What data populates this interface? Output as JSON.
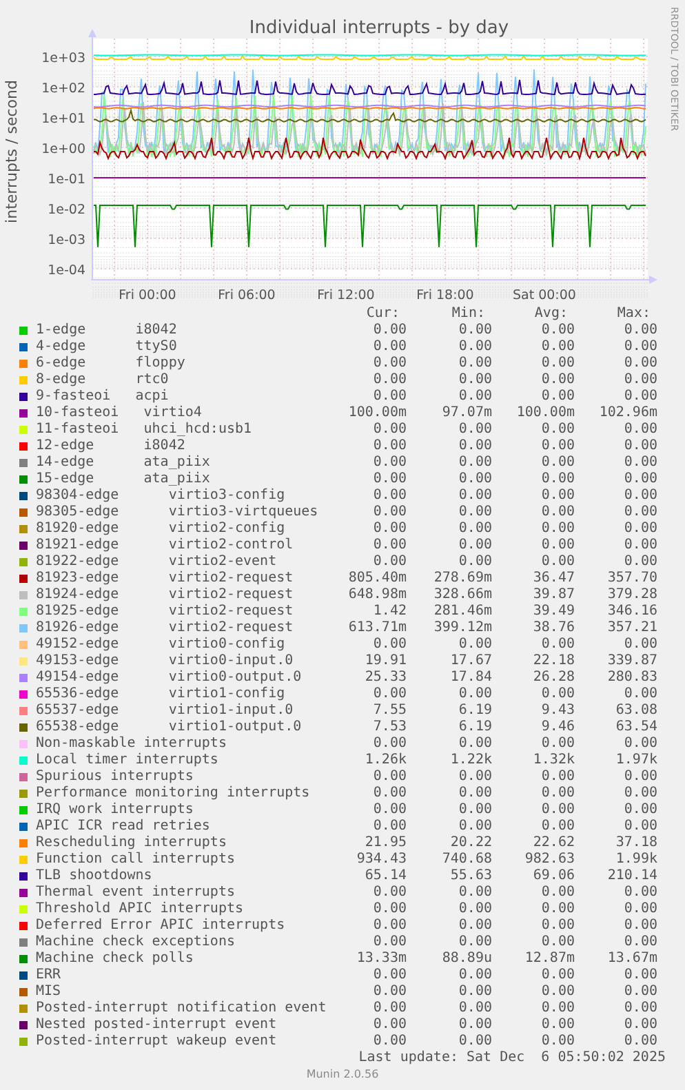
{
  "chart": {
    "title": "Individual interrupts - by day",
    "ylabel": "interrupts / second",
    "credit": "RRDTOOL / TOBI OETIKER",
    "yticks": [
      "1e+03",
      "1e+02",
      "1e+01",
      "1e+00",
      "1e-01",
      "1e-02",
      "1e-03",
      "1e-04"
    ],
    "xticks": [
      "Fri 00:00",
      "Fri 06:00",
      "Fri 12:00",
      "Fri 18:00",
      "Sat 00:00"
    ]
  },
  "legend": {
    "columns": [
      "Cur:",
      "Min:",
      "Avg:",
      "Max:"
    ],
    "rows": [
      {
        "label": "1-edge      i8042",
        "color": "#00cc00",
        "cur": "0.00",
        "min": "0.00",
        "avg": "0.00",
        "max": "0.00"
      },
      {
        "label": "4-edge      ttyS0",
        "color": "#0066b3",
        "cur": "0.00",
        "min": "0.00",
        "avg": "0.00",
        "max": "0.00"
      },
      {
        "label": "6-edge      floppy",
        "color": "#ff8000",
        "cur": "0.00",
        "min": "0.00",
        "avg": "0.00",
        "max": "0.00"
      },
      {
        "label": "8-edge      rtc0",
        "color": "#ffcc00",
        "cur": "0.00",
        "min": "0.00",
        "avg": "0.00",
        "max": "0.00"
      },
      {
        "label": "9-fasteoi   acpi",
        "color": "#330099",
        "cur": "0.00",
        "min": "0.00",
        "avg": "0.00",
        "max": "0.00"
      },
      {
        "label": "10-fasteoi   virtio4",
        "color": "#990099",
        "cur": "100.00m",
        "min": "97.07m",
        "avg": "100.00m",
        "max": "102.96m"
      },
      {
        "label": "11-fasteoi   uhci_hcd:usb1",
        "color": "#ccff00",
        "cur": "0.00",
        "min": "0.00",
        "avg": "0.00",
        "max": "0.00"
      },
      {
        "label": "12-edge      i8042",
        "color": "#ff0000",
        "cur": "0.00",
        "min": "0.00",
        "avg": "0.00",
        "max": "0.00"
      },
      {
        "label": "14-edge      ata_piix",
        "color": "#808080",
        "cur": "0.00",
        "min": "0.00",
        "avg": "0.00",
        "max": "0.00"
      },
      {
        "label": "15-edge      ata_piix",
        "color": "#008f00",
        "cur": "0.00",
        "min": "0.00",
        "avg": "0.00",
        "max": "0.00"
      },
      {
        "label": "98304-edge      virtio3-config",
        "color": "#00487d",
        "cur": "0.00",
        "min": "0.00",
        "avg": "0.00",
        "max": "0.00"
      },
      {
        "label": "98305-edge      virtio3-virtqueues",
        "color": "#b35a00",
        "cur": "0.00",
        "min": "0.00",
        "avg": "0.00",
        "max": "0.00"
      },
      {
        "label": "81920-edge      virtio2-config",
        "color": "#b38f00",
        "cur": "0.00",
        "min": "0.00",
        "avg": "0.00",
        "max": "0.00"
      },
      {
        "label": "81921-edge      virtio2-control",
        "color": "#6b006b",
        "cur": "0.00",
        "min": "0.00",
        "avg": "0.00",
        "max": "0.00"
      },
      {
        "label": "81922-edge      virtio2-event",
        "color": "#8fb300",
        "cur": "0.00",
        "min": "0.00",
        "avg": "0.00",
        "max": "0.00"
      },
      {
        "label": "81923-edge      virtio2-request",
        "color": "#b30000",
        "cur": "805.40m",
        "min": "278.69m",
        "avg": "36.47",
        "max": "357.70"
      },
      {
        "label": "81924-edge      virtio2-request",
        "color": "#bebebe",
        "cur": "648.98m",
        "min": "328.66m",
        "avg": "39.87",
        "max": "379.28"
      },
      {
        "label": "81925-edge      virtio2-request",
        "color": "#80ff80",
        "cur": "1.42",
        "min": "281.46m",
        "avg": "39.49",
        "max": "346.16"
      },
      {
        "label": "81926-edge      virtio2-request",
        "color": "#80c9ff",
        "cur": "613.71m",
        "min": "399.12m",
        "avg": "38.76",
        "max": "357.21"
      },
      {
        "label": "49152-edge      virtio0-config",
        "color": "#ffc080",
        "cur": "0.00",
        "min": "0.00",
        "avg": "0.00",
        "max": "0.00"
      },
      {
        "label": "49153-edge      virtio0-input.0",
        "color": "#ffe680",
        "cur": "19.91",
        "min": "17.67",
        "avg": "22.18",
        "max": "339.87"
      },
      {
        "label": "49154-edge      virtio0-output.0",
        "color": "#aa80ff",
        "cur": "25.33",
        "min": "17.84",
        "avg": "26.28",
        "max": "280.83"
      },
      {
        "label": "65536-edge      virtio1-config",
        "color": "#ee00cc",
        "cur": "0.00",
        "min": "0.00",
        "avg": "0.00",
        "max": "0.00"
      },
      {
        "label": "65537-edge      virtio1-input.0",
        "color": "#ff8080",
        "cur": "7.55",
        "min": "6.19",
        "avg": "9.43",
        "max": "63.08"
      },
      {
        "label": "65538-edge      virtio1-output.0",
        "color": "#666600",
        "cur": "7.53",
        "min": "6.19",
        "avg": "9.46",
        "max": "63.54"
      },
      {
        "label": "Non-maskable interrupts",
        "color": "#ffbfff",
        "cur": "0.00",
        "min": "0.00",
        "avg": "0.00",
        "max": "0.00"
      },
      {
        "label": "Local timer interrupts",
        "color": "#00ffcc",
        "cur": "1.26k",
        "min": "1.22k",
        "avg": "1.32k",
        "max": "1.97k"
      },
      {
        "label": "Spurious interrupts",
        "color": "#cc6699",
        "cur": "0.00",
        "min": "0.00",
        "avg": "0.00",
        "max": "0.00"
      },
      {
        "label": "Performance monitoring interrupts",
        "color": "#999900",
        "cur": "0.00",
        "min": "0.00",
        "avg": "0.00",
        "max": "0.00"
      },
      {
        "label": "IRQ work interrupts",
        "color": "#00cc00",
        "cur": "0.00",
        "min": "0.00",
        "avg": "0.00",
        "max": "0.00"
      },
      {
        "label": "APIC ICR read retries",
        "color": "#0066b3",
        "cur": "0.00",
        "min": "0.00",
        "avg": "0.00",
        "max": "0.00"
      },
      {
        "label": "Rescheduling interrupts",
        "color": "#ff8000",
        "cur": "21.95",
        "min": "20.22",
        "avg": "22.62",
        "max": "37.18"
      },
      {
        "label": "Function call interrupts",
        "color": "#ffcc00",
        "cur": "934.43",
        "min": "740.68",
        "avg": "982.63",
        "max": "1.99k"
      },
      {
        "label": "TLB shootdowns",
        "color": "#330099",
        "cur": "65.14",
        "min": "55.63",
        "avg": "69.06",
        "max": "210.14"
      },
      {
        "label": "Thermal event interrupts",
        "color": "#990099",
        "cur": "0.00",
        "min": "0.00",
        "avg": "0.00",
        "max": "0.00"
      },
      {
        "label": "Threshold APIC interrupts",
        "color": "#ccff00",
        "cur": "0.00",
        "min": "0.00",
        "avg": "0.00",
        "max": "0.00"
      },
      {
        "label": "Deferred Error APIC interrupts",
        "color": "#ff0000",
        "cur": "0.00",
        "min": "0.00",
        "avg": "0.00",
        "max": "0.00"
      },
      {
        "label": "Machine check exceptions",
        "color": "#808080",
        "cur": "0.00",
        "min": "0.00",
        "avg": "0.00",
        "max": "0.00"
      },
      {
        "label": "Machine check polls",
        "color": "#008f00",
        "cur": "13.33m",
        "min": "88.89u",
        "avg": "12.87m",
        "max": "13.67m"
      },
      {
        "label": "ERR",
        "color": "#00487d",
        "cur": "0.00",
        "min": "0.00",
        "avg": "0.00",
        "max": "0.00"
      },
      {
        "label": "MIS",
        "color": "#b35a00",
        "cur": "0.00",
        "min": "0.00",
        "avg": "0.00",
        "max": "0.00"
      },
      {
        "label": "Posted-interrupt notification event",
        "color": "#b38f00",
        "cur": "0.00",
        "min": "0.00",
        "avg": "0.00",
        "max": "0.00"
      },
      {
        "label": "Nested posted-interrupt event",
        "color": "#6b006b",
        "cur": "0.00",
        "min": "0.00",
        "avg": "0.00",
        "max": "0.00"
      },
      {
        "label": "Posted-interrupt wakeup event",
        "color": "#8fb300",
        "cur": "0.00",
        "min": "0.00",
        "avg": "0.00",
        "max": "0.00"
      }
    ]
  },
  "last_update": "Last update: Sat Dec  6 05:50:02 2025",
  "footer": "Munin 2.0.56"
}
